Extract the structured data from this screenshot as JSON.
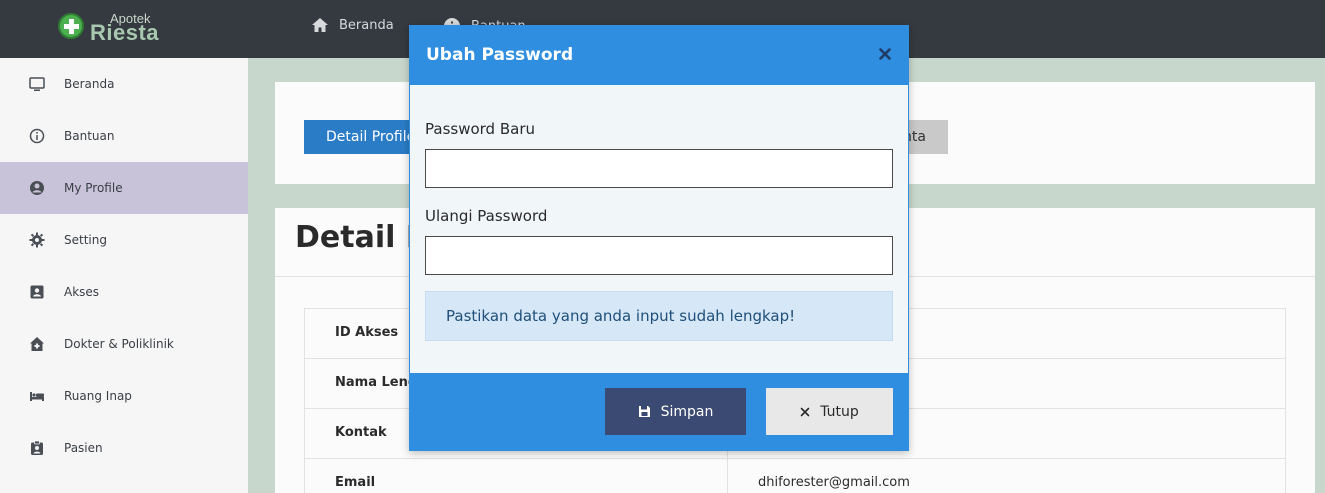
{
  "app": {
    "logo_small": "Apotek",
    "logo_big": "Riesta"
  },
  "topnav": {
    "items": [
      {
        "label": "Beranda",
        "icon": "home-icon"
      },
      {
        "label": "Bantuan",
        "icon": "info-icon"
      }
    ]
  },
  "sidebar": {
    "active_item": "My Profile",
    "items": [
      {
        "label": "Beranda",
        "icon": "monitor-icon"
      },
      {
        "label": "Bantuan",
        "icon": "info-circle-icon"
      },
      {
        "label": "My Profile",
        "icon": "user-circle-icon"
      },
      {
        "label": "Setting",
        "icon": "gear-icon"
      },
      {
        "label": "Akses",
        "icon": "id-card-icon"
      },
      {
        "label": "Dokter & Poliklinik",
        "icon": "clinic-icon"
      },
      {
        "label": "Ruang Inap",
        "icon": "bed-icon"
      },
      {
        "label": "Pasien",
        "icon": "clipboard-user-icon"
      }
    ]
  },
  "main": {
    "tabs": [
      {
        "label": "Detail Profile"
      },
      {
        "label": "nta"
      }
    ],
    "section_title": "Detail P",
    "table": {
      "rows": [
        {
          "label": "ID Akses",
          "value": ""
        },
        {
          "label": "Nama Leng",
          "value": ""
        },
        {
          "label": "Kontak",
          "value": ""
        },
        {
          "label": "Email",
          "value": "dhiforester@gmail.com"
        }
      ]
    }
  },
  "modal": {
    "title": "Ubah Password",
    "fields": {
      "new_password": {
        "label": "Password Baru",
        "value": "",
        "placeholder": ""
      },
      "repeat_password": {
        "label": "Ulangi Password",
        "value": "",
        "placeholder": ""
      }
    },
    "alert": "Pastikan data yang anda input sudah lengkap!",
    "save_label": "Simpan",
    "close_label": "Tutup"
  },
  "colors": {
    "primary": "#2f8ee0",
    "save_button": "#3b4a72",
    "navbar": "#343a40",
    "sidebar_active": "#c9c3d9",
    "alert_bg": "#d6e8f8"
  }
}
